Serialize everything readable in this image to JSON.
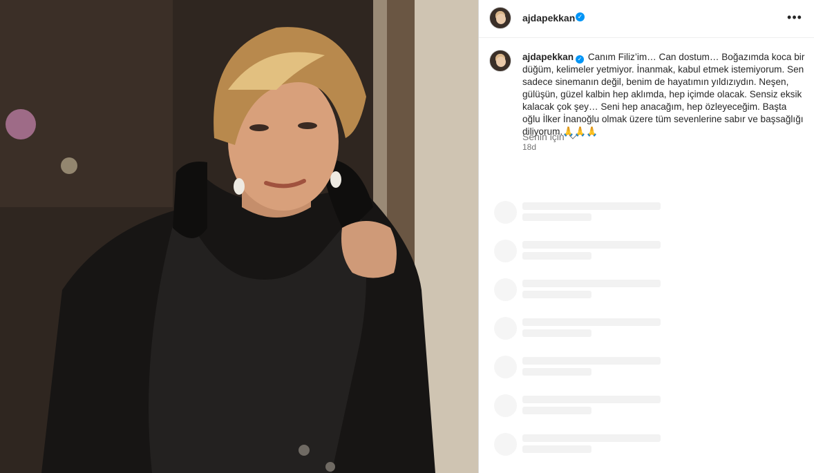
{
  "post": {
    "username": "ajdapekkan",
    "verified_icon": "verified-badge-icon",
    "more_icon": "more-options-icon",
    "more_label": "•••"
  },
  "caption": {
    "username": "ajdapekkan",
    "text": "Canım Filiz’im… Can dostum… Boğazımda koca bir düğüm, kelimeler yetmiyor. İnanmak, kabul etmek istemiyorum. Sen sadece sinemanın değil, benim de hayatımın yıldızıydın. Neşen, gülüşün, güzel kalbin hep aklımda, hep içimde olacak. Sensiz eksik kalacak çok şey… Seni hep anacağım, hep özleyeceğim. Başta oğlu İlker İnanoğlu olmak üzere tüm sevenlerine sabır ve başsağlığı diliyorum.🙏🙏🙏",
    "timestamp": "18d"
  },
  "comments": {
    "filter_label": "Senin için",
    "skeleton_count": 7
  },
  "colors": {
    "accent": "#0095f6",
    "text": "#262626",
    "secondary": "#737373",
    "skeleton": "#f2f2f2"
  }
}
